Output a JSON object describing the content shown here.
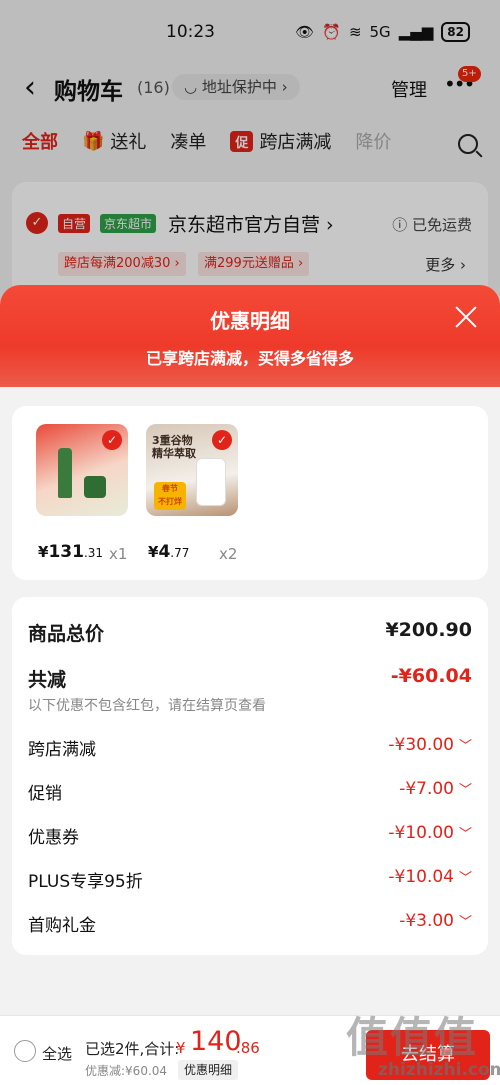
{
  "status_bar": {
    "time": "10:23",
    "network": "5G",
    "battery": "82"
  },
  "nav": {
    "title": "购物车",
    "count": "(16)",
    "address": "◡ 地址保护中 ›",
    "manage": "管理",
    "msg_badge": "5+"
  },
  "filters": [
    {
      "label": "全部"
    },
    {
      "label": "送礼"
    },
    {
      "label": "凑单"
    },
    {
      "label": "跨店满减",
      "tag": "促"
    },
    {
      "label": "降价"
    }
  ],
  "store": {
    "tag_self": "自营",
    "tag_market": "京东超市",
    "name": "京东超市官方自营 ›",
    "shipping": "ⓘ 已免运费",
    "coupons": [
      "跨店每满200减30 ›",
      "满299元送赠品 ›"
    ],
    "more": "更多 ›"
  },
  "sheet": {
    "title": "优惠明细",
    "subtitle": "已享跨店满减，买得多省得多"
  },
  "products": [
    {
      "price_symbol": "¥",
      "price_int": "131",
      "price_dec": ".31",
      "qty": "x1",
      "thumb_text": ""
    },
    {
      "price_symbol": "¥",
      "price_int": "4",
      "price_dec": ".77",
      "qty": "x2",
      "thumb_text": "3重谷物\n精华萃取",
      "sticker": "春节\n不打烊"
    }
  ],
  "summary": {
    "total_label": "商品总价",
    "total_value": "¥200.90",
    "cut_label": "共减",
    "cut_value": "-¥60.04",
    "note": "以下优惠不包含红包，请在结算页查看",
    "items": [
      {
        "label": "跨店满减",
        "value": "-¥30.00"
      },
      {
        "label": "促销",
        "value": "-¥7.00"
      },
      {
        "label": "优惠券",
        "value": "-¥10.00"
      },
      {
        "label": "PLUS专享95折",
        "value": "-¥10.04"
      },
      {
        "label": "首购礼金",
        "value": "-¥3.00"
      }
    ]
  },
  "bottom_bar": {
    "select_all": "全选",
    "selected_text": "已选2件,合计:",
    "sum_symbol": "¥",
    "sum_int": "140",
    "sum_dec": ".86",
    "saved_text": "优惠减:¥60.04",
    "detail_toggle": "优惠明细",
    "checkout": "去结算"
  },
  "watermark": {
    "main": "值值值",
    "sub": "zhizhizhi.com"
  },
  "colors": {
    "accent": "#e2231a",
    "header_gradient_top": "#f44a37"
  }
}
